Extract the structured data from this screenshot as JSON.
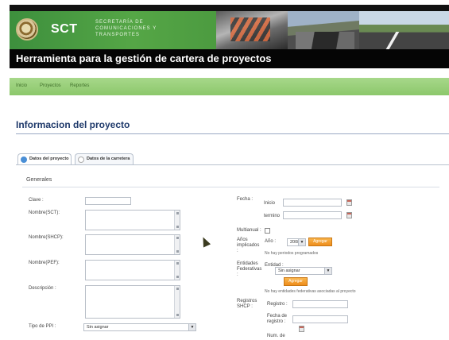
{
  "header": {
    "logo_text": "SCT",
    "secretaria_lines": "SECRETARÍA DE COMUNICACIONES Y TRANSPORTES",
    "app_title": "Herramienta para la gestión de cartera de proyectos"
  },
  "nav": {
    "items": [
      "Inicio",
      "Proyectos",
      "Reportes"
    ]
  },
  "page": {
    "title": "Informacion del proyecto"
  },
  "tabs": [
    {
      "label": "Datos del proyecto",
      "active": true
    },
    {
      "label": "Datos de la carretera",
      "active": false
    }
  ],
  "section": {
    "title": "Generales"
  },
  "form": {
    "clave_label": "Clave :",
    "nombre_sct_label": "Nombre(SCT):",
    "nombre_shcp_label": "Nombre(SHCP):",
    "nombre_pef_label": "Nombre(PEF):",
    "descripcion_label": "Descripción :",
    "tipo_ppi_label": "Tipo de PPI :",
    "tipo_ppi_value": "Sin asignar",
    "fecha_label": "Fecha :",
    "inicio_label": "Inicio",
    "termino_label": "termino",
    "multianual_label": "Multianual :",
    "anios_label": "Años implicados :",
    "anio_label": "Año :",
    "anio_value": "2008",
    "agregar_label": "Agregar",
    "no_periodos_note": "No hay periodos programados",
    "entidades_label": "Entidades Federativas :",
    "entidad_label": "Entidad :",
    "entidad_value": "Sin asignar",
    "entidad_btn_label": "Agregar",
    "no_entidades_note": "No hay entidades federativas asociadas al proyecto",
    "registros_label": "Registros SHCP :",
    "registro_label": "Registro :",
    "fecha_registro_label": "Fecha de registro :",
    "num_label": "Num. de"
  },
  "colors": {
    "nav_green": "#8cc76b",
    "title_blue": "#1f3a6b",
    "button_orange": "#ee8d1c"
  }
}
